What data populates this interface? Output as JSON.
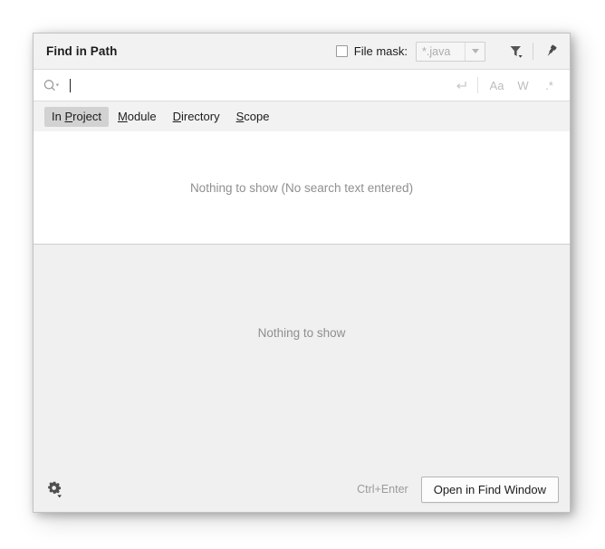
{
  "dialog": {
    "title": "Find in Path"
  },
  "header": {
    "file_mask_label": "File mask:",
    "file_mask_checked": false,
    "file_mask_value": "*.java",
    "filter_icon": "filter-funnel-icon",
    "pin_icon": "pin-icon"
  },
  "search": {
    "icon": "search-magnifier-icon",
    "value": "",
    "placeholder": "",
    "return_icon": "return-arrow-icon",
    "options": [
      {
        "id": "match-case",
        "label": "Aa"
      },
      {
        "id": "words",
        "label": "W"
      },
      {
        "id": "regex",
        "label": ".*"
      }
    ]
  },
  "scope_tabs": [
    {
      "id": "in-project",
      "pre": "In ",
      "mnemonic": "P",
      "post": "roject",
      "selected": true
    },
    {
      "id": "module",
      "pre": "",
      "mnemonic": "M",
      "post": "odule",
      "selected": false
    },
    {
      "id": "directory",
      "pre": "",
      "mnemonic": "D",
      "post": "irectory",
      "selected": false
    },
    {
      "id": "scope",
      "pre": "",
      "mnemonic": "S",
      "post": "cope",
      "selected": false
    }
  ],
  "results": {
    "empty_text": "Nothing to show (No search text entered)"
  },
  "preview": {
    "empty_text": "Nothing to show"
  },
  "footer": {
    "settings_icon": "gear-icon",
    "shortcut_hint": "Ctrl+Enter",
    "open_button_label": "Open in Find Window"
  },
  "colors": {
    "dialog_background": "#f2f2f2",
    "preview_background": "#f0f0f0",
    "selected_tab": "#d2d2d2",
    "muted_text": "#8f8f8f",
    "border": "#c2c2c2"
  }
}
